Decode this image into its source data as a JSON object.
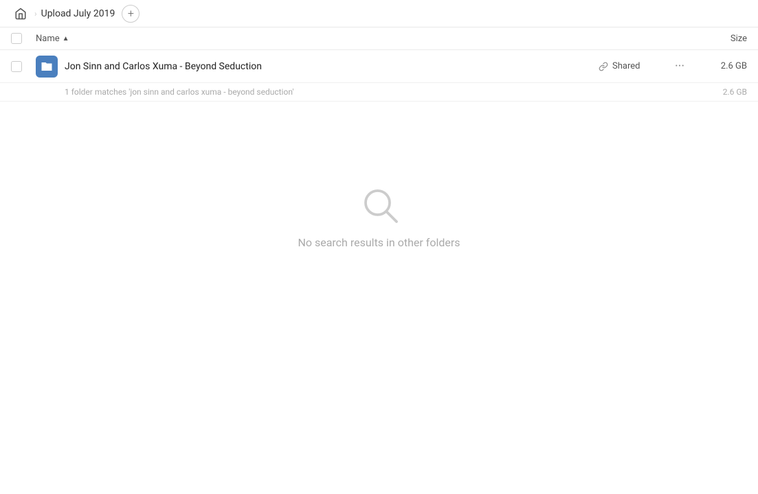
{
  "header": {
    "home_title": "Home",
    "breadcrumb_title": "Upload July 2019",
    "new_folder_label": "+"
  },
  "columns": {
    "name_label": "Name",
    "sort_arrow": "▲",
    "size_label": "Size"
  },
  "file_row": {
    "name": "Jon Sinn and Carlos Xuma - Beyond Seduction",
    "shared_label": "Shared",
    "size": "2.6 GB",
    "more_label": "···"
  },
  "match_row": {
    "text": "1 folder matches 'jon sinn and carlos xuma - beyond seduction'",
    "size": "2.6 GB"
  },
  "empty_state": {
    "text": "No search results in other folders"
  }
}
